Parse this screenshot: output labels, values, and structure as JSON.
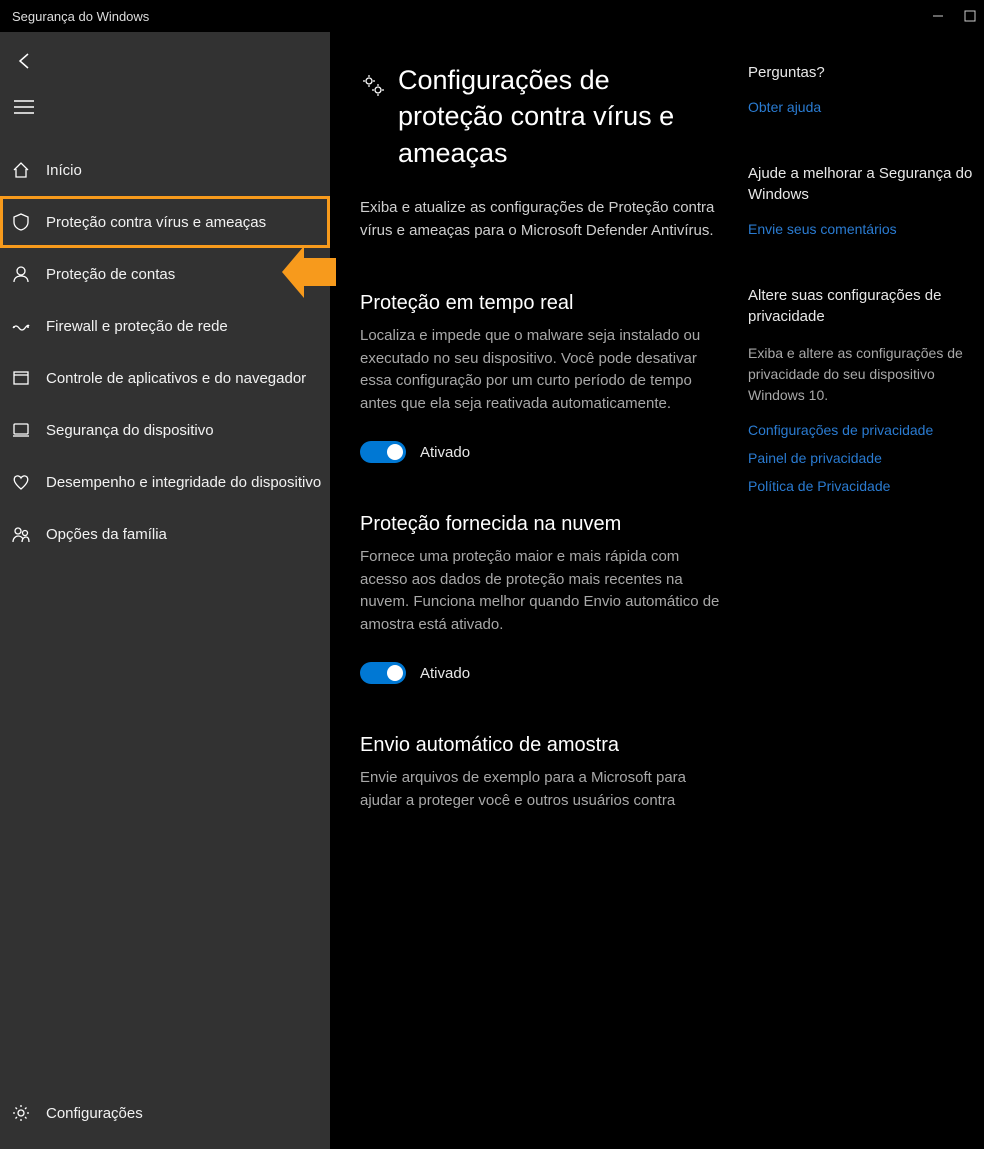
{
  "window": {
    "title": "Segurança do Windows"
  },
  "sidebar": {
    "items": [
      {
        "label": "Início"
      },
      {
        "label": "Proteção contra vírus e ameaças"
      },
      {
        "label": "Proteção de contas"
      },
      {
        "label": "Firewall e proteção de rede"
      },
      {
        "label": "Controle de aplicativos e do navegador"
      },
      {
        "label": "Segurança do dispositivo"
      },
      {
        "label": "Desempenho e integridade do dispositivo"
      },
      {
        "label": "Opções da família"
      }
    ],
    "bottom": {
      "label": "Configurações"
    }
  },
  "main": {
    "title": "Configurações de proteção contra vírus e ameaças",
    "lead": "Exiba e atualize as configurações de Proteção contra vírus e ameaças para o Microsoft Defender Antivírus.",
    "sections": [
      {
        "heading": "Proteção em tempo real",
        "desc": "Localiza e impede que o malware seja instalado ou executado no seu dispositivo. Você pode desativar essa configuração por um curto período de tempo antes que ela seja reativada automaticamente.",
        "toggle_state": "Ativado"
      },
      {
        "heading": "Proteção fornecida na nuvem",
        "desc": "Fornece uma proteção maior e mais rápida com acesso aos dados de proteção mais recentes na nuvem. Funciona melhor quando Envio automático de amostra está ativado.",
        "toggle_state": "Ativado"
      },
      {
        "heading": "Envio automático de amostra",
        "desc": "Envie arquivos de exemplo para a Microsoft para ajudar a proteger você e outros usuários contra"
      }
    ]
  },
  "aside": {
    "sections": [
      {
        "heading": "Perguntas?",
        "links": [
          "Obter ajuda"
        ]
      },
      {
        "heading": "Ajude a melhorar a Segurança do Windows",
        "links": [
          "Envie seus comentários"
        ]
      },
      {
        "heading": "Altere suas configurações de privacidade",
        "desc": "Exiba e altere as configurações de privacidade do seu dispositivo Windows 10.",
        "links": [
          "Configurações de privacidade",
          "Painel de privacidade",
          "Política de Privacidade"
        ]
      }
    ]
  }
}
